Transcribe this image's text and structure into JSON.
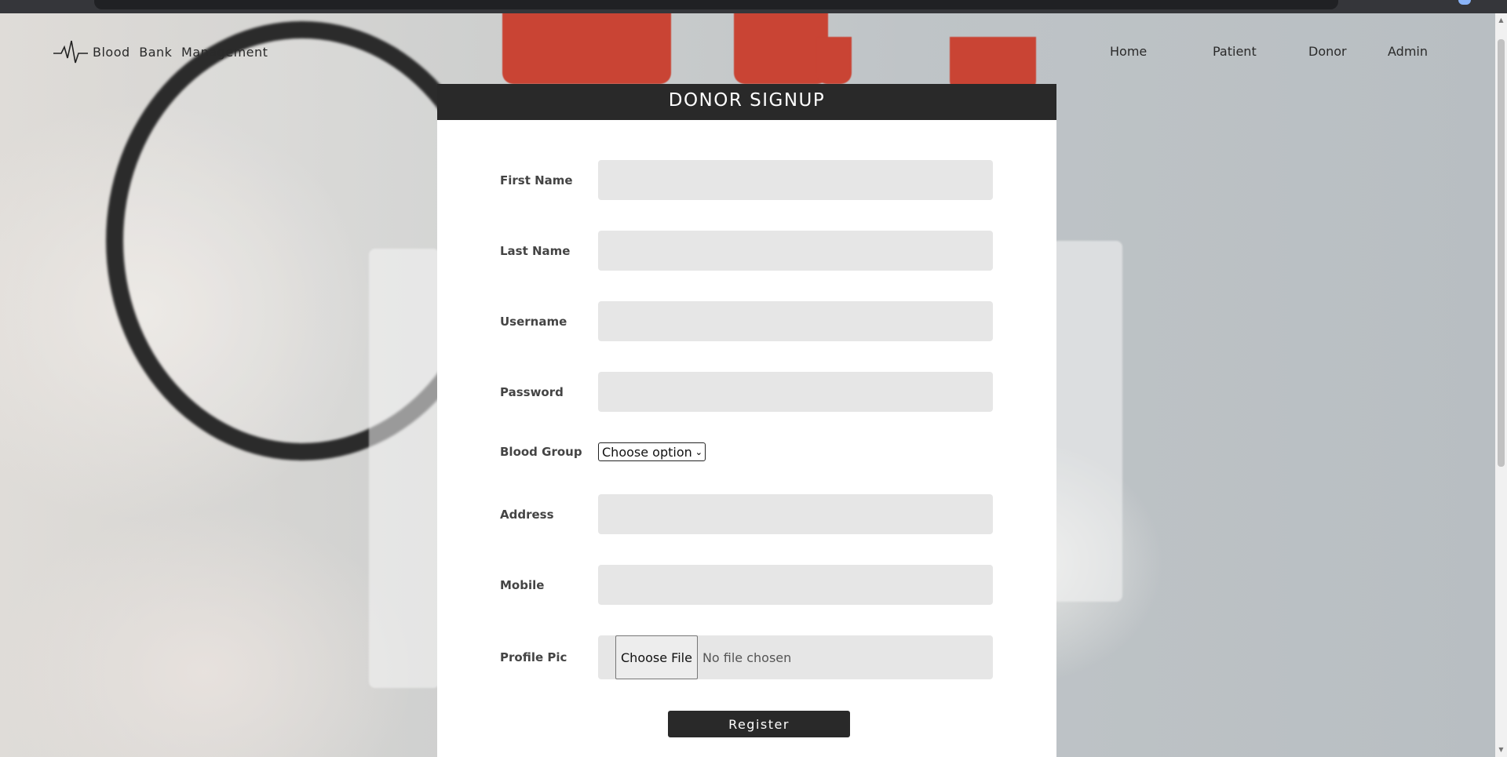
{
  "brand": {
    "name": "Blood  Bank  Management"
  },
  "nav": {
    "home": "Home",
    "patient": "Patient",
    "donor": "Donor",
    "admin": "Admin"
  },
  "form": {
    "title": "DONOR SIGNUP",
    "fields": {
      "first_name": "First Name",
      "last_name": "Last Name",
      "username": "Username",
      "password": "Password",
      "blood_group": "Blood Group",
      "address": "Address",
      "mobile": "Mobile",
      "profile_pic": "Profile Pic"
    },
    "blood_group_select": "Choose option",
    "file": {
      "button": "Choose File",
      "status": "No file chosen"
    },
    "submit": "Register"
  }
}
